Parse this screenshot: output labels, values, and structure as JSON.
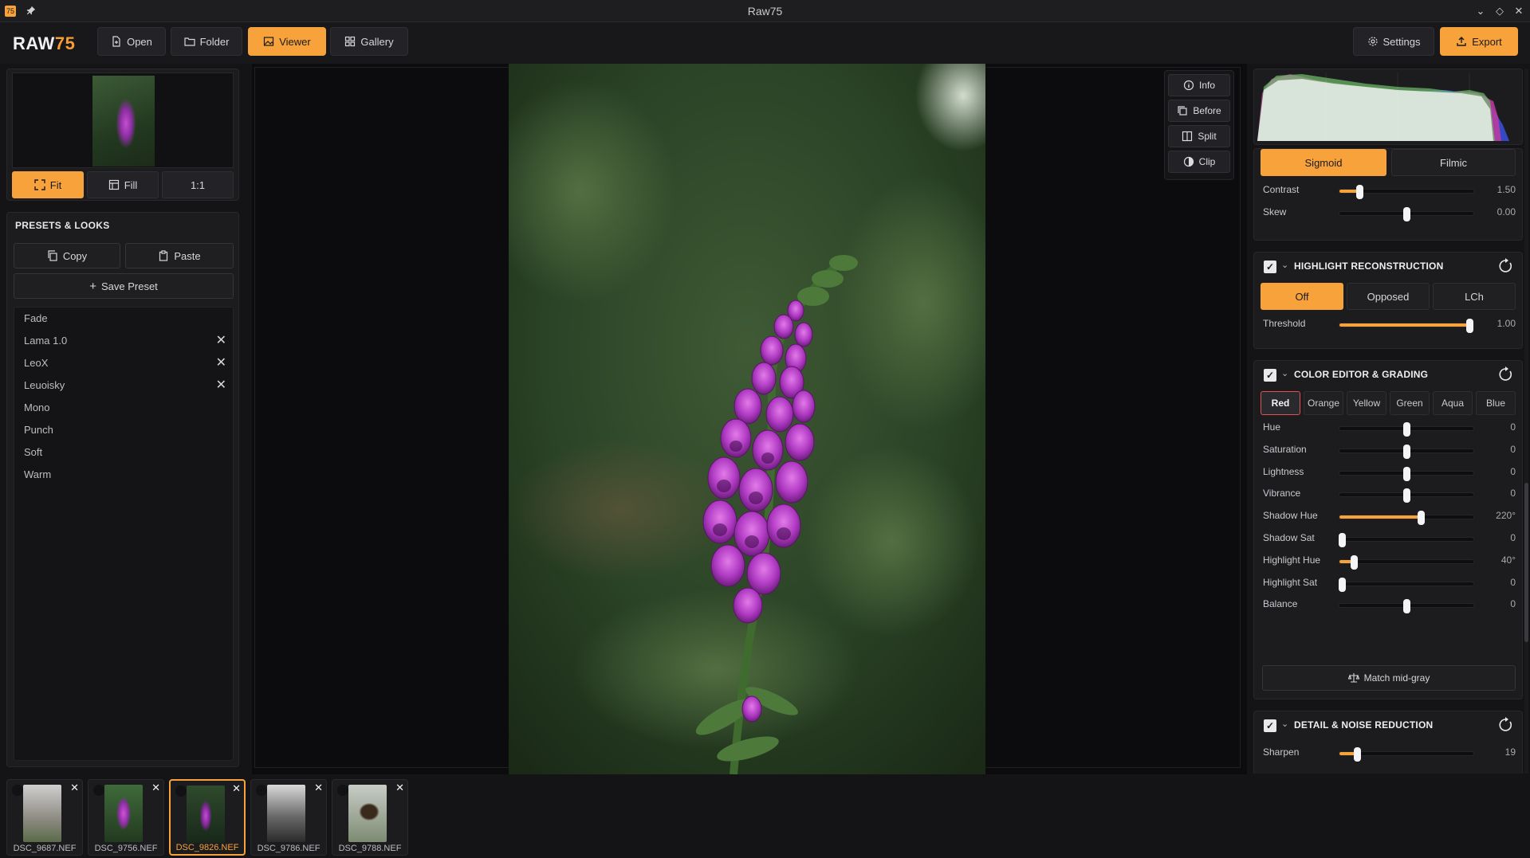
{
  "window": {
    "title": "Raw75",
    "app_icon": "75"
  },
  "logo": {
    "main": "RAW",
    "accent": "75"
  },
  "nav": {
    "open": "Open",
    "folder": "Folder",
    "viewer": "Viewer",
    "gallery": "Gallery",
    "settings": "Settings",
    "export": "Export"
  },
  "zoom": {
    "fit": "Fit",
    "fill": "Fill",
    "one": "1:1"
  },
  "presets": {
    "title": "PRESETS & LOOKS",
    "copy": "Copy",
    "paste": "Paste",
    "save": "Save Preset",
    "items": [
      {
        "name": "Fade",
        "removable": false
      },
      {
        "name": "Lama 1.0",
        "removable": true
      },
      {
        "name": "LeoX",
        "removable": true
      },
      {
        "name": "Leuoisky",
        "removable": true
      },
      {
        "name": "Mono",
        "removable": false
      },
      {
        "name": "Punch",
        "removable": false
      },
      {
        "name": "Soft",
        "removable": false
      },
      {
        "name": "Warm",
        "removable": false
      }
    ]
  },
  "overlay": {
    "info": "Info",
    "before": "Before",
    "split": "Split",
    "clip": "Clip"
  },
  "tone": {
    "sigmoid": "Sigmoid",
    "filmic": "Filmic",
    "active_mode": "Sigmoid",
    "sliders": [
      {
        "label": "Contrast",
        "value": "1.50",
        "pos": 0.15,
        "filled": true
      },
      {
        "label": "Skew",
        "value": "0.00",
        "pos": 0.5,
        "filled": false
      }
    ]
  },
  "highlight": {
    "title": "HIGHLIGHT RECONSTRUCTION",
    "modes": [
      "Off",
      "Opposed",
      "LCh"
    ],
    "active_mode": "Off",
    "sliders": [
      {
        "label": "Threshold",
        "value": "1.00",
        "pos": 0.97,
        "filled": true
      }
    ]
  },
  "color": {
    "title": "COLOR EDITOR & GRADING",
    "tabs": [
      "Red",
      "Orange",
      "Yellow",
      "Green",
      "Aqua",
      "Blue"
    ],
    "active_tab": "Red",
    "sliders": [
      {
        "label": "Hue",
        "value": "0",
        "pos": 0.5,
        "filled": false
      },
      {
        "label": "Saturation",
        "value": "0",
        "pos": 0.5,
        "filled": false
      },
      {
        "label": "Lightness",
        "value": "0",
        "pos": 0.5,
        "filled": false
      },
      {
        "label": "Vibrance",
        "value": "0",
        "pos": 0.5,
        "filled": false
      },
      {
        "label": "Shadow Hue",
        "value": "220°",
        "pos": 0.61,
        "filled": true
      },
      {
        "label": "Shadow Sat",
        "value": "0",
        "pos": 0.02,
        "filled": false
      },
      {
        "label": "Highlight Hue",
        "value": "40°",
        "pos": 0.11,
        "filled": true
      },
      {
        "label": "Highlight Sat",
        "value": "0",
        "pos": 0.02,
        "filled": false
      },
      {
        "label": "Balance",
        "value": "0",
        "pos": 0.5,
        "filled": false
      }
    ],
    "match": "Match mid-gray"
  },
  "detail": {
    "title": "DETAIL & NOISE REDUCTION",
    "sliders": [
      {
        "label": "Sharpen",
        "value": "19",
        "pos": 0.13,
        "filled": true
      }
    ]
  },
  "filmstrip": [
    {
      "name": "DSC_9687.NEF",
      "active": false,
      "tone": "goat"
    },
    {
      "name": "DSC_9756.NEF",
      "active": false,
      "tone": "foxglove"
    },
    {
      "name": "DSC_9826.NEF",
      "active": true,
      "tone": "foxglove-dark"
    },
    {
      "name": "DSC_9786.NEF",
      "active": false,
      "tone": "mono"
    },
    {
      "name": "DSC_9788.NEF",
      "active": false,
      "tone": "bird"
    }
  ],
  "colors": {
    "accent": "#f7a23b",
    "background": "#141416",
    "panel": "#1c1c1f",
    "tab_active_border": "#e05252"
  }
}
